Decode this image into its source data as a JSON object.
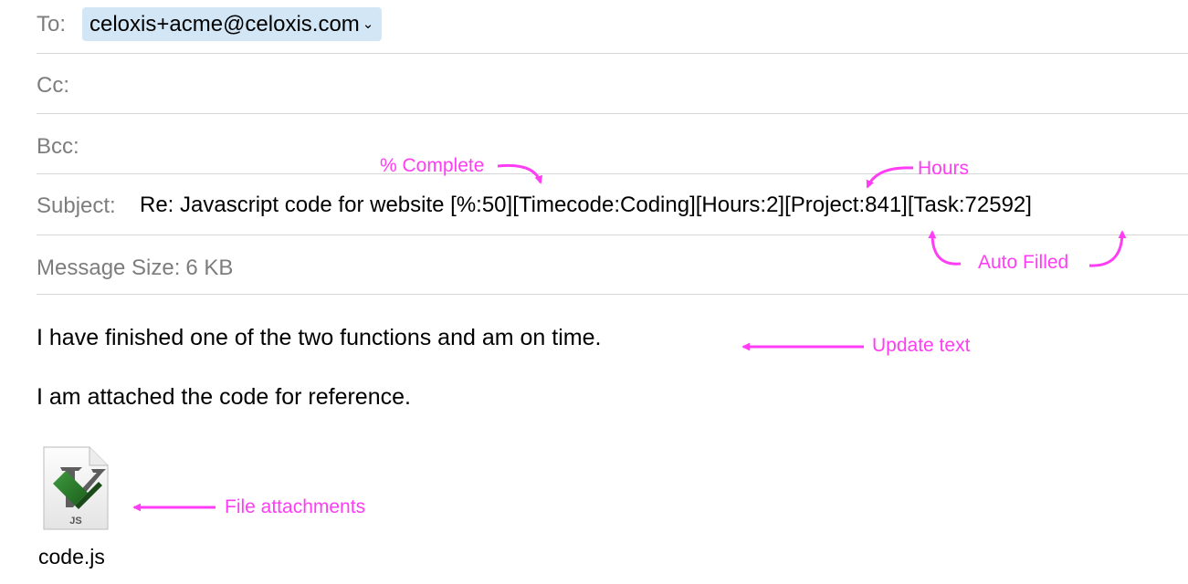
{
  "header": {
    "to_label": "To:",
    "to_recipient": "celoxis+acme@celoxis.com",
    "to_chevron": "⌄",
    "cc_label": "Cc:",
    "bcc_label": "Bcc:",
    "subject_label": "Subject:",
    "subject_value": "Re: Javascript code for website [%:50][Timecode:Coding][Hours:2][Project:841][Task:72592]",
    "size_label": "Message Size:",
    "size_value": "6 KB"
  },
  "body": {
    "line1": "I have finished one of the two functions and am on time.",
    "line2": "I am attached the code for reference."
  },
  "attachment": {
    "icon": "js-file-icon",
    "icon_text": "JS",
    "name": "code.js"
  },
  "annotations": {
    "color": "#ff3df4",
    "complete": "% Complete",
    "hours": "Hours",
    "auto_filled": "Auto Filled",
    "update_text": "Update text",
    "file_attachments": "File attachments"
  },
  "colors": {
    "label_gray": "#7d7d7d",
    "recipient_bg": "#d3e6f6",
    "separator": "#d6d6d6",
    "annotation": "#ff3df4"
  }
}
